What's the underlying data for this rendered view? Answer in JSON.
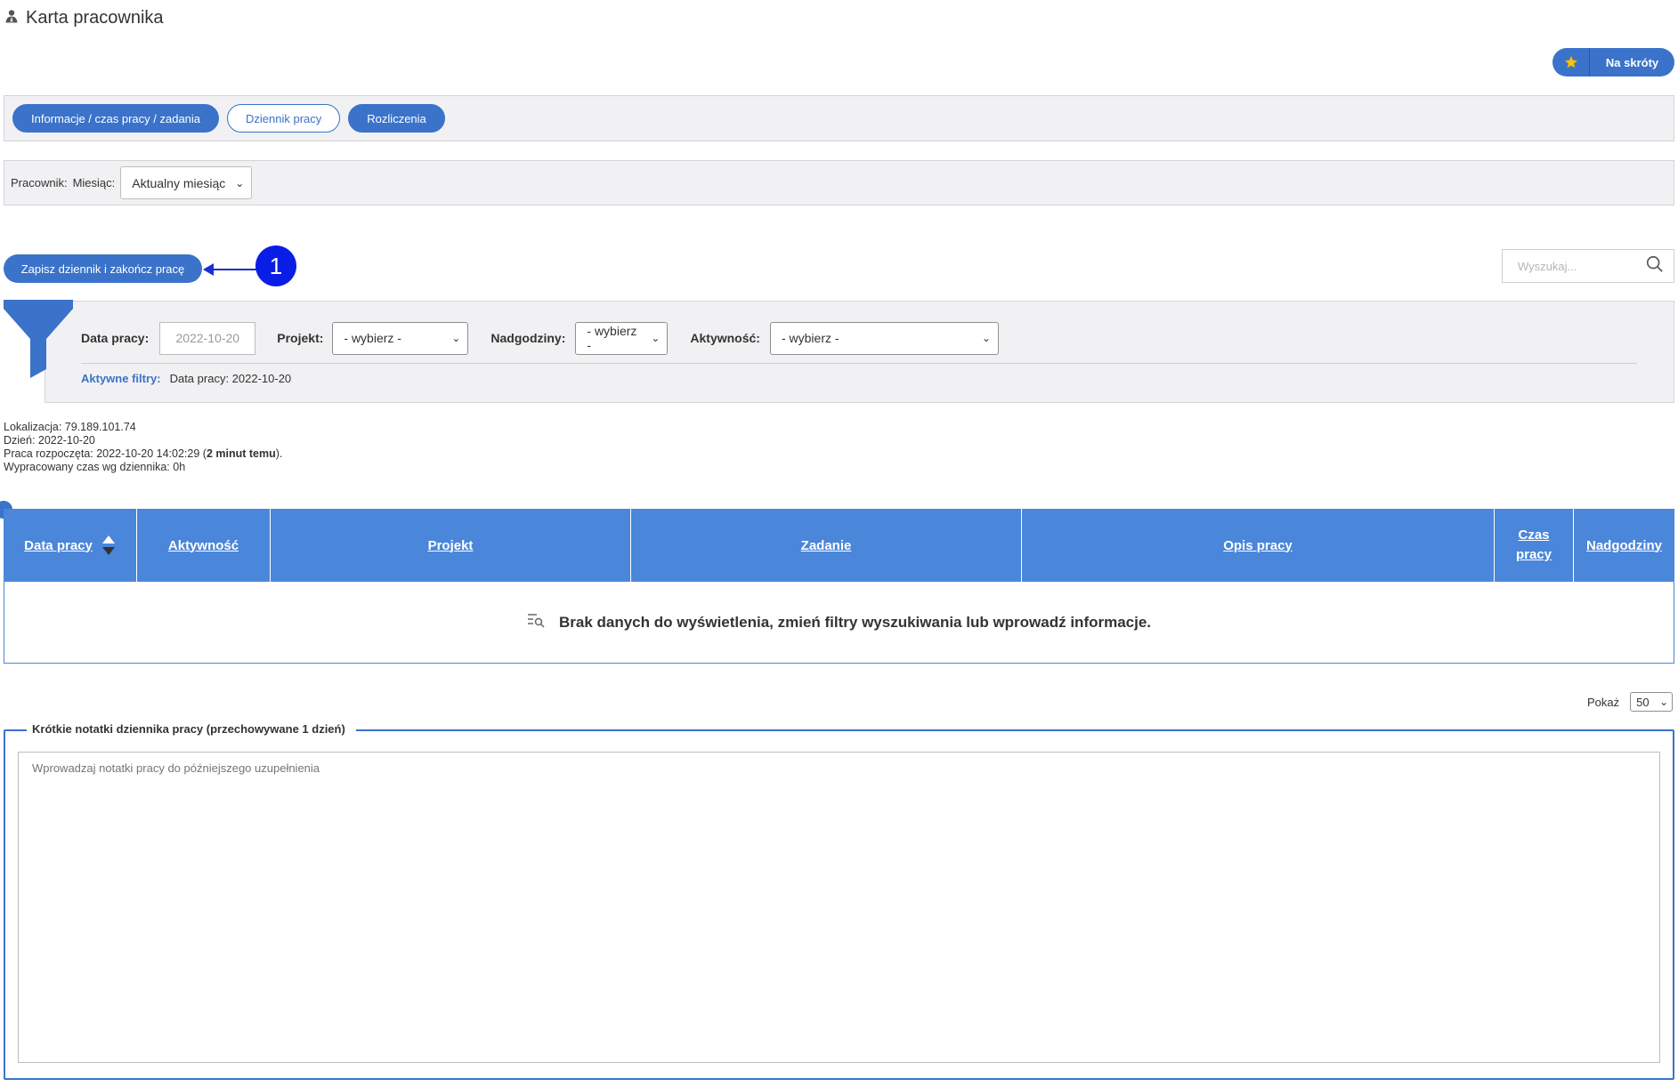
{
  "header": {
    "title": "Karta pracownika",
    "icon": "user-icon"
  },
  "shortcuts": {
    "label": "Na skróty",
    "icon": "star-icon"
  },
  "tabs": [
    {
      "label": "Informacje / czas pracy / zadania",
      "style": "filled"
    },
    {
      "label": "Dziennik pracy",
      "style": "outline"
    },
    {
      "label": "Rozliczenia",
      "style": "filled"
    }
  ],
  "month_bar": {
    "employee_label": "Pracownik:",
    "month_label": "Miesiąc:",
    "month_value": "Aktualny miesiąc"
  },
  "save_button": {
    "label": "Zapisz dziennik i zakończ pracę"
  },
  "annotation": {
    "number": "1"
  },
  "search": {
    "placeholder": "Wyszukaj..."
  },
  "filters": {
    "date_label": "Data pracy:",
    "date_value": "2022-10-20",
    "project_label": "Projekt:",
    "project_value": "- wybierz -",
    "overtime_label": "Nadgodziny:",
    "overtime_value": "- wybierz -",
    "activity_label": "Aktywność:",
    "activity_value": "- wybierz -",
    "active_label": "Aktywne filtry:",
    "active_value": "Data pracy: 2022-10-20"
  },
  "info": {
    "location": "Lokalizacja: 79.189.101.74",
    "day": "Dzień: 2022-10-20",
    "started_prefix": "Praca rozpoczęta: 2022-10-20 14:02:29 (",
    "started_bold": "2 minut temu",
    "started_suffix": ").",
    "worked": "Wypracowany czas wg dziennika: 0h"
  },
  "table": {
    "columns": [
      "Data pracy",
      "Aktywność",
      "Projekt",
      "Zadanie",
      "Opis pracy",
      "Czas pracy",
      "Nadgodziny"
    ],
    "empty_message": "Brak danych do wyświetlenia, zmień filtry wyszukiwania lub wprowadź informacje."
  },
  "pagination": {
    "label": "Pokaż",
    "value": "50"
  },
  "notes": {
    "legend": "Krótkie notatki dziennika pracy (przechowywane 1 dzień)",
    "placeholder": "Wprowadzaj notatki pracy do późniejszego uzupełnienia"
  },
  "colors": {
    "accent": "#3a73c9",
    "table_header": "#4a86d9",
    "annotation": "#0a1de6"
  }
}
